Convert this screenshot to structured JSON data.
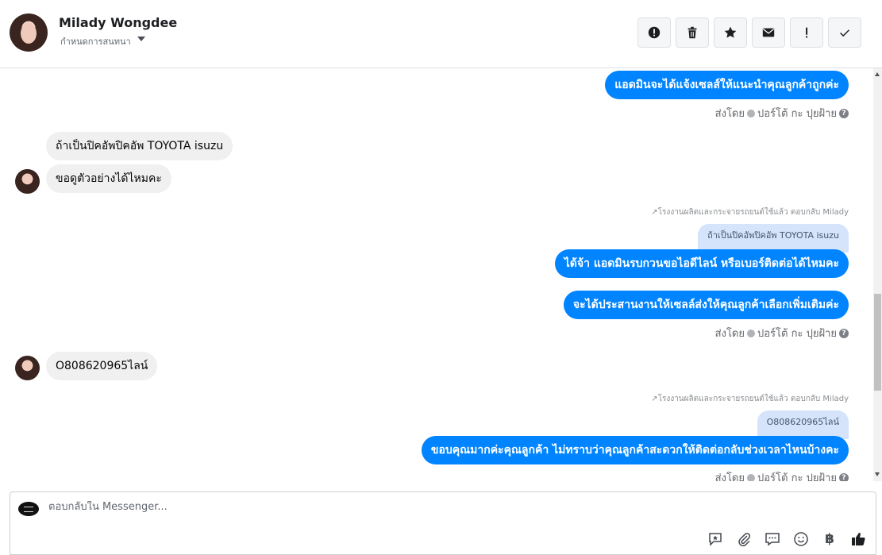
{
  "header": {
    "name": "Milady Wongdee",
    "subtitle": "กำหนดการสนทนา",
    "actions": [
      "alert-circle-icon",
      "trash-icon",
      "star-icon",
      "envelope-icon",
      "exclamation-icon",
      "check-icon"
    ]
  },
  "messages": {
    "m1": "แอดมินจะได้แจ้งเซลส์ให้แนะนำคุณลูกค้าถูกค่ะ",
    "sent1": "ส่งโดย",
    "sender1": "ปอร์โต้ กะ ปุยฝ้าย",
    "m2": "ถ้าเป็นปิคอัพปิคอัพ TOYOTA isuzu",
    "m3": "ขอดูตัวอย่างได้ไหมคะ",
    "reply_meta1": "โรงงานผลิตและกระจายรถยนต์ใช้แล้ว ตอบกลับ Milady",
    "reply_quote1": "ถ้าเป็นปิคอัพปิคอัพ TOYOTA isuzu",
    "m4": "ได้จ้า แอดมินรบกวนขอไอดีไลน์ หรือเบอร์ติดต่อได้ไหมคะ",
    "m5": "จะได้ประสานงานให้เซลล์ส่งให้คุณลูกค้าเลือกเพิ่มเติมค่ะ",
    "sent2": "ส่งโดย",
    "sender2": "ปอร์โต้ กะ ปุยฝ้าย",
    "m6": "O808620965ไลน์",
    "reply_meta2": "โรงงานผลิตและกระจายรถยนต์ใช้แล้ว ตอบกลับ Milady",
    "reply_quote2": "O808620965ไลน์",
    "m7": "ขอบคุณมากค่ะคุณลูกค้า ไม่ทราบว่าคุณลูกค้าสะดวกให้ติดต่อกลับช่วงเวลาไหนบ้างคะ",
    "sent3": "ส่งโดย",
    "sender3": "ปอร์โต้ กะ ปุยฝ้าย"
  },
  "composer": {
    "placeholder": "ตอบกลับใน Messenger...",
    "baht_symbol": "฿",
    "icons": [
      "saved-reply-icon",
      "paperclip-icon",
      "chat-bubbles-icon",
      "smiley-icon",
      "baht-icon",
      "thumbs-up-icon"
    ]
  }
}
